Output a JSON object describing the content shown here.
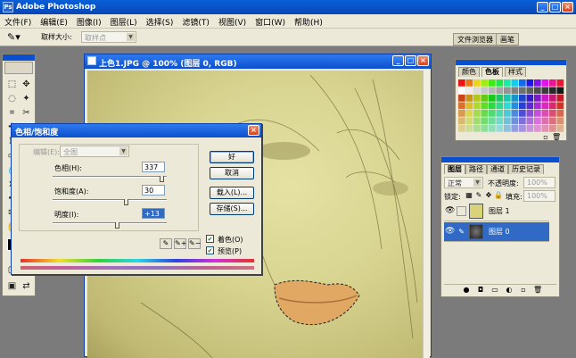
{
  "app": {
    "title": "Adobe Photoshop",
    "logo": "Ps"
  },
  "menu": [
    "文件(F)",
    "编辑(E)",
    "图像(I)",
    "图层(L)",
    "选择(S)",
    "滤镜(T)",
    "视图(V)",
    "窗口(W)",
    "帮助(H)"
  ],
  "options": {
    "sample_label": "取样大小:",
    "sample_value": "取样点",
    "dock_tabs": [
      "文件浏览器",
      "画笔"
    ]
  },
  "document": {
    "title": "上色1.JPG @ 100% (图层 0, RGB)"
  },
  "dialog": {
    "title": "色相/饱和度",
    "edit_label": "编辑(E):",
    "edit_value": "全图",
    "hue_label": "色相(H):",
    "hue_value": "337",
    "sat_label": "饱和度(A):",
    "sat_value": "30",
    "light_label": "明度(I):",
    "light_value": "+13",
    "hue_level": 0.96,
    "sat_level": 0.65,
    "light_level": 0.57,
    "buttons": {
      "ok": "好",
      "cancel": "取消",
      "load": "载入(L)...",
      "save": "存储(S)..."
    },
    "colorize_label": "着色(O)",
    "colorize_checked": true,
    "preview_label": "预览(P)",
    "preview_checked": true
  },
  "swatches_panel": {
    "tabs": [
      "颜色",
      "色板",
      "样式"
    ]
  },
  "layers_panel": {
    "tabs": [
      "图层",
      "路径",
      "通道",
      "历史记录"
    ],
    "blend_mode": "正常",
    "opacity_label": "不透明度:",
    "opacity_value": "100%",
    "lock_label": "锁定:",
    "fill_label": "填充:",
    "fill_value": "100%",
    "layers": [
      {
        "name": "图层 1",
        "active": false,
        "thumb_color": "#d8d27a"
      },
      {
        "name": "图层 0",
        "active": true,
        "thumb_color": "#444444"
      }
    ]
  },
  "colors": {
    "title_blue": "#0b4fcc",
    "chrome": "#ece9d8",
    "selection": "#316ac5"
  }
}
